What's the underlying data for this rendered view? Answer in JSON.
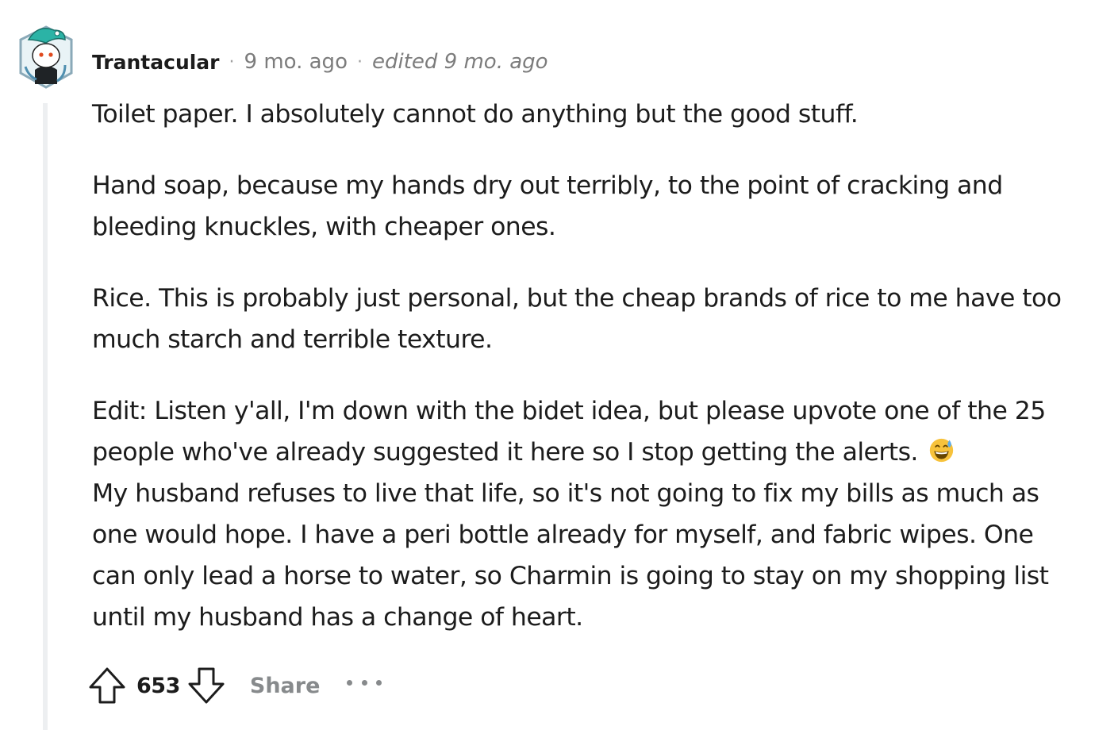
{
  "comment": {
    "author": "Trantacular",
    "time": "9 mo. ago",
    "edited": "edited 9 mo. ago",
    "paragraphs": [
      "Toilet paper. I absolutely cannot do anything but the good stuff.",
      "Hand soap, because my hands dry out terribly, to the point of cracking and bleeding knuckles, with cheaper ones.",
      "Rice. This is probably just personal, but the cheap brands of rice to me have too much starch and terrible texture.",
      "Edit: Listen y'all, I'm down with the bidet idea, but please upvote one of the 25 people who've already suggested it here so I stop getting the alerts."
    ],
    "edit_continuation": "My husband refuses to live that life, so it's not going to fix my bills as much as one would hope. I have a peri bottle already for myself, and fabric wipes. One can only lead a horse to water, so Charmin is going to stay on my shopping list until my husband has a change of heart.",
    "emoji": "grinning-face-with-sweat-emoji"
  },
  "actions": {
    "score": "653",
    "share_label": "Share"
  },
  "icons": {
    "avatar": "snoo-avatar-icon",
    "upvote": "upvote-arrow-icon",
    "downvote": "downvote-arrow-icon",
    "more": "more-options-icon"
  },
  "colors": {
    "text": "#1c1c1c",
    "meta": "#7c7c7c",
    "muted": "#878a8c",
    "thread_line": "#edeff1"
  }
}
